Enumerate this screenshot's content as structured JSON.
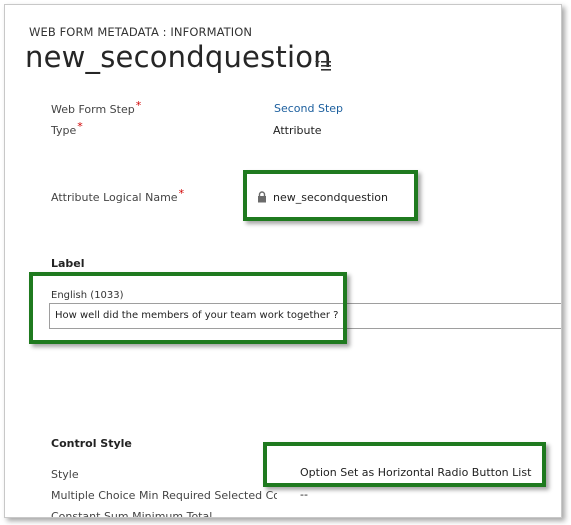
{
  "header": {
    "entity_label": "WEB FORM METADATA : INFORMATION",
    "record_title": "new_secondquestion"
  },
  "fields": {
    "web_form_step": {
      "label": "Web Form Step",
      "required": "*",
      "value": "Second Step"
    },
    "type": {
      "label": "Type",
      "required": "*",
      "value": "Attribute"
    },
    "attribute_logical_name": {
      "label": "Attribute Logical Name",
      "required": "*",
      "value": "new_secondquestion"
    }
  },
  "label_section": {
    "title": "Label",
    "language": "English (1033)",
    "text": "How well did the members of your team work together ?"
  },
  "control_style_section": {
    "title": "Control Style",
    "style": {
      "label": "Style",
      "value": "Option Set as Horizontal Radio Button List"
    },
    "multiple_choice_min": {
      "label": "Multiple Choice Min Required Selected Cou",
      "value": "--"
    },
    "partial_row_label": "Constant Sum Minimum Total"
  },
  "colors": {
    "highlight": "#1f7a1f",
    "link": "#1c5f9e",
    "required": "#d00000"
  },
  "icons": [
    "menu-icon",
    "lock-icon"
  ]
}
